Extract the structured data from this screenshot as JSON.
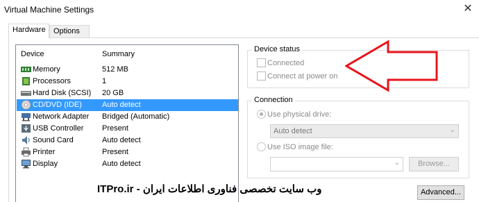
{
  "window": {
    "title": "Virtual Machine Settings",
    "close_glyph": "✕"
  },
  "tabs": [
    {
      "label": "Hardware",
      "active": true
    },
    {
      "label": "Options",
      "active": false
    }
  ],
  "device_list": {
    "headers": {
      "device": "Device",
      "summary": "Summary"
    },
    "rows": [
      {
        "device": "Memory",
        "summary": "512 MB",
        "icon": "memory-icon"
      },
      {
        "device": "Processors",
        "summary": "1",
        "icon": "processor-icon"
      },
      {
        "device": "Hard Disk (SCSI)",
        "summary": "20 GB",
        "icon": "hard-disk-icon"
      },
      {
        "device": "CD/DVD (IDE)",
        "summary": "Auto detect",
        "icon": "cd-dvd-icon",
        "selected": true
      },
      {
        "device": "Network Adapter",
        "summary": "Bridged (Automatic)",
        "icon": "network-adapter-icon"
      },
      {
        "device": "USB Controller",
        "summary": "Present",
        "icon": "usb-icon"
      },
      {
        "device": "Sound Card",
        "summary": "Auto detect",
        "icon": "sound-card-icon"
      },
      {
        "device": "Printer",
        "summary": "Present",
        "icon": "printer-icon"
      },
      {
        "device": "Display",
        "summary": "Auto detect",
        "icon": "display-icon"
      }
    ]
  },
  "device_status": {
    "legend": "Device status",
    "connected": {
      "label": "Connected",
      "checked": false
    },
    "connect_at_power_on": {
      "label": "Connect at power on",
      "checked": false
    }
  },
  "connection": {
    "legend": "Connection",
    "use_physical_drive": {
      "label": "Use physical drive:",
      "selected": true
    },
    "drive_select": {
      "value": "Auto detect"
    },
    "use_iso": {
      "label": "Use ISO image file:",
      "selected": false
    },
    "iso_path": {
      "value": ""
    },
    "browse_label": "Browse..."
  },
  "advanced_label": "Advanced...",
  "watermark": "وب سایت تخصصی فناوری اطلاعات ایران - ITPro.ir",
  "colors": {
    "selection": "#3399ff",
    "annotation_arrow": "#e8141c"
  }
}
